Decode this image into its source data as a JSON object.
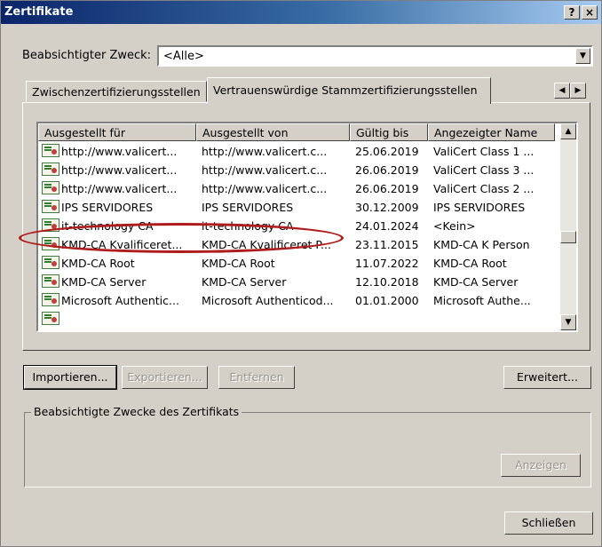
{
  "window": {
    "title": "Zertifikate",
    "help": "?",
    "close": "×"
  },
  "purpose": {
    "label": "Beabsichtigter Zweck:",
    "value": "<Alle>"
  },
  "tabs": [
    {
      "label": "Zwischenzertifizierungsstellen"
    },
    {
      "label": "Vertrauenswürdige Stammzertifizierungsstellen"
    }
  ],
  "list": {
    "columns": [
      "Ausgestellt für",
      "Ausgestellt von",
      "Gültig bis",
      "Angezeigter Name"
    ],
    "rows": [
      {
        "for": "http://www.valicert...",
        "by": "http://www.valicert.c...",
        "until": "25.06.2019",
        "name": "ValiCert Class 1 ..."
      },
      {
        "for": "http://www.valicert...",
        "by": "http://www.valicert.c...",
        "until": "26.06.2019",
        "name": "ValiCert Class 3 ..."
      },
      {
        "for": "http://www.valicert...",
        "by": "http://www.valicert.c...",
        "until": "26.06.2019",
        "name": "ValiCert Class 2 ..."
      },
      {
        "for": "IPS SERVIDORES",
        "by": "IPS SERVIDORES",
        "until": "30.12.2009",
        "name": "IPS SERVIDORES"
      },
      {
        "for": "it-technology CA",
        "by": "it-technology CA",
        "until": "24.01.2024",
        "name": "<Kein>"
      },
      {
        "for": "KMD-CA Kvalificeret...",
        "by": "KMD-CA Kvalificeret P...",
        "until": "23.11.2015",
        "name": "KMD-CA K Person"
      },
      {
        "for": "KMD-CA Root",
        "by": "KMD-CA Root",
        "until": "11.07.2022",
        "name": "KMD-CA Root"
      },
      {
        "for": "KMD-CA Server",
        "by": "KMD-CA Server",
        "until": "12.10.2018",
        "name": "KMD-CA Server"
      },
      {
        "for": "Microsoft Authentic...",
        "by": "Microsoft Authenticod...",
        "until": "01.01.2000",
        "name": "Microsoft Authe..."
      }
    ]
  },
  "buttons": {
    "import": "Importieren...",
    "export": "Exportieren...",
    "remove": "Entfernen",
    "advanced": "Erweitert...",
    "show": "Anzeigen",
    "close": "Schließen"
  },
  "group": {
    "label": "Beabsichtigte Zwecke des Zertifikats"
  },
  "icons": {
    "certificate": "certificate-icon"
  },
  "colors": {
    "titlebar": "#0a246a",
    "highlight": "#b01c1c",
    "face": "#d4d0c8"
  }
}
